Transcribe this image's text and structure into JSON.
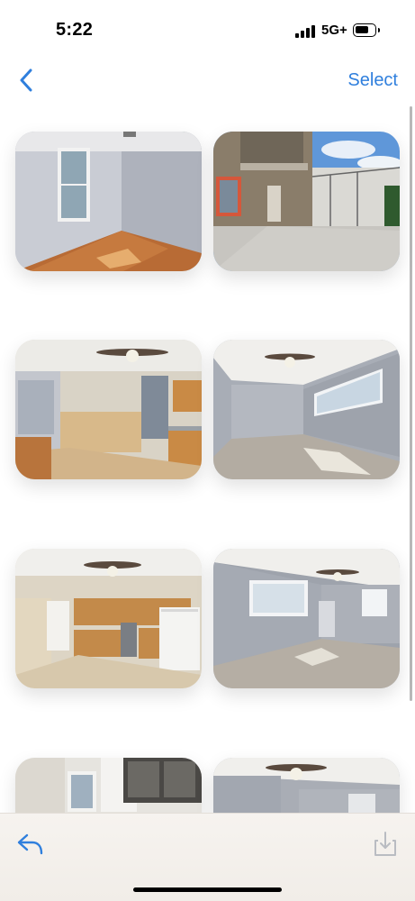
{
  "status_bar": {
    "time": "5:22",
    "network": "5G+",
    "icons": [
      "signal-bars-icon",
      "battery-icon"
    ]
  },
  "nav": {
    "back_icon": "chevron-left-icon",
    "select_label": "Select",
    "accent_color": "#2f7fdd"
  },
  "gallery": {
    "photos": [
      {
        "subject": "empty-room-window-hardwood-floor"
      },
      {
        "subject": "backyard-patio-balcony"
      },
      {
        "subject": "kitchen-dining-ceiling-fan"
      },
      {
        "subject": "living-room-ceiling-fan-windows"
      },
      {
        "subject": "kitchen-wood-cabinets-fridge"
      },
      {
        "subject": "living-room-gray-walls-ceiling-fan"
      },
      {
        "subject": "kitchen-upper-cabinets"
      },
      {
        "subject": "room-ceiling-fan"
      }
    ]
  },
  "toolbar": {
    "reply_icon": "reply-arrow-icon",
    "download_icon": "download-tray-icon"
  }
}
